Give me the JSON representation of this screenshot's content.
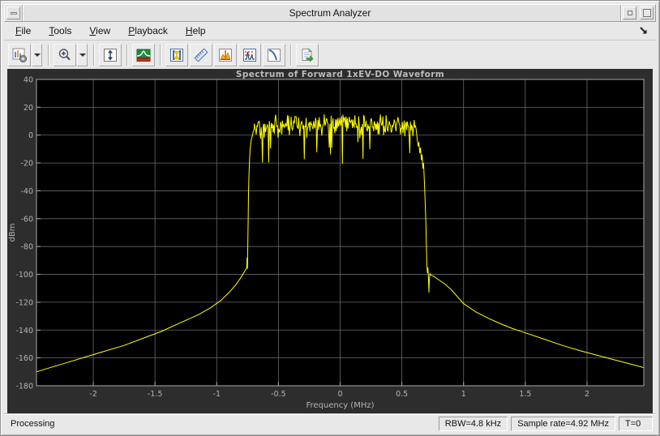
{
  "window": {
    "title": "Spectrum Analyzer"
  },
  "titlebar": {
    "icons": {
      "window_menu": "dash",
      "minimize": "small-square",
      "maximize": "large-square"
    }
  },
  "menu": {
    "items": [
      {
        "label": "File",
        "accel_index": 0
      },
      {
        "label": "Tools",
        "accel_index": 0
      },
      {
        "label": "View",
        "accel_index": 0
      },
      {
        "label": "Playback",
        "accel_index": 0
      },
      {
        "label": "Help",
        "accel_index": 0
      }
    ],
    "dock_icon": "arrow-down-right"
  },
  "toolbar": {
    "buttons": [
      {
        "name": "scope-options",
        "icon": "scope-settings-icon",
        "dropdown": true
      },
      {
        "name": "zoom-in",
        "icon": "zoom-in-icon",
        "dropdown": true
      },
      {
        "name": "autoscale-y",
        "icon": "autoscale-y-icon"
      },
      {
        "name": "spectrum-settings",
        "icon": "spectrum-settings-icon"
      },
      {
        "name": "cursor-measurements",
        "icon": "cursor-measurements-icon"
      },
      {
        "name": "signal-statistics",
        "icon": "ruler-icon"
      },
      {
        "name": "peak-finder",
        "icon": "peak-finder-icon"
      },
      {
        "name": "distortion-measurements",
        "icon": "distortion-measurements-icon"
      },
      {
        "name": "ccdf-measurements",
        "icon": "ccdf-measurements-icon"
      },
      {
        "name": "export",
        "icon": "export-icon"
      }
    ]
  },
  "statusbar": {
    "status": "Processing",
    "rbw": "RBW=4.8 kHz",
    "sample_rate": "Sample rate=4.92 MHz",
    "time": "T=0"
  },
  "colors": {
    "trace": "#ffff00",
    "axes_bg": "#000000",
    "figure_bg": "#2d2d2d",
    "grid": "#6a6a6a",
    "frame": "#a8a8a8",
    "tick_text": "#b4b4b4",
    "title_text": "#bcbcbc"
  },
  "chart_data": {
    "type": "line",
    "title": "Spectrum of Forward 1xEV-DO Waveform",
    "xlabel": "Frequency (MHz)",
    "ylabel": "dBm",
    "xlim": [
      -2.46,
      2.46
    ],
    "ylim": [
      -180,
      40
    ],
    "xticks": [
      -2,
      -1.5,
      -1,
      -0.5,
      0,
      0.5,
      1,
      1.5,
      2
    ],
    "yticks": [
      40,
      20,
      0,
      -20,
      -40,
      -60,
      -80,
      -100,
      -120,
      -140,
      -160,
      -180
    ],
    "grid": true,
    "legend": "none",
    "series": [
      {
        "name": "spectrum",
        "color": "#ffff00",
        "left_tail": [
          [
            -2.46,
            -170
          ],
          [
            -2.35,
            -167
          ],
          [
            -2.2,
            -163
          ],
          [
            -2.05,
            -159
          ],
          [
            -1.9,
            -155
          ],
          [
            -1.75,
            -151
          ],
          [
            -1.6,
            -146
          ],
          [
            -1.45,
            -141
          ],
          [
            -1.3,
            -135
          ],
          [
            -1.15,
            -129
          ],
          [
            -1.05,
            -124
          ],
          [
            -0.97,
            -119
          ],
          [
            -0.9,
            -113
          ],
          [
            -0.85,
            -108
          ],
          [
            -0.81,
            -103
          ],
          [
            -0.785,
            -99.5
          ],
          [
            -0.768,
            -97
          ],
          [
            -0.76,
            -95.8
          ]
        ],
        "left_skirt": [
          [
            -0.757,
            -95
          ],
          [
            -0.754,
            -88
          ],
          [
            -0.751,
            -96
          ],
          [
            -0.748,
            -80
          ],
          [
            -0.745,
            -60
          ],
          [
            -0.742,
            -42
          ],
          [
            -0.738,
            -28
          ],
          [
            -0.733,
            -16
          ],
          [
            -0.727,
            -8
          ],
          [
            -0.719,
            -3
          ],
          [
            -0.71,
            0
          ],
          [
            -0.702,
            3
          ],
          [
            -0.697,
            4
          ]
        ],
        "passband_noise": {
          "x_start": -0.695,
          "x_end": 0.615,
          "points": 260,
          "mean": 5,
          "sigma": 4,
          "dome_amp": 2.5,
          "dome_half_width": 0.75,
          "clip_max": 15,
          "dip_probability": 0.09,
          "dip_extra_min": 6,
          "dip_extra_max": 28,
          "seed": 20127
        },
        "right_skirt": [
          [
            0.618,
            2
          ],
          [
            0.625,
            -3
          ],
          [
            0.632,
            -8
          ],
          [
            0.638,
            -5
          ],
          [
            0.645,
            -13
          ],
          [
            0.651,
            -9
          ],
          [
            0.658,
            -18
          ],
          [
            0.664,
            -14
          ],
          [
            0.67,
            -24
          ],
          [
            0.676,
            -20
          ],
          [
            0.682,
            -32
          ],
          [
            0.688,
            -45
          ],
          [
            0.694,
            -62
          ],
          [
            0.699,
            -80
          ],
          [
            0.703,
            -93
          ],
          [
            0.707,
            -99
          ],
          [
            0.711,
            -95
          ],
          [
            0.716,
            -104
          ],
          [
            0.719,
            -113
          ],
          [
            0.723,
            -103
          ],
          [
            0.728,
            -99.5
          ]
        ],
        "right_tail": [
          [
            0.735,
            -100.5
          ],
          [
            0.76,
            -101.5
          ],
          [
            0.8,
            -104
          ],
          [
            0.85,
            -107
          ],
          [
            0.9,
            -111
          ],
          [
            0.95,
            -116
          ],
          [
            1.0,
            -121
          ],
          [
            1.1,
            -127
          ],
          [
            1.2,
            -131.5
          ],
          [
            1.3,
            -135.5
          ],
          [
            1.4,
            -139
          ],
          [
            1.5,
            -142
          ],
          [
            1.65,
            -146.5
          ],
          [
            1.8,
            -151
          ],
          [
            1.95,
            -155
          ],
          [
            2.1,
            -158.5
          ],
          [
            2.25,
            -162
          ],
          [
            2.4,
            -165.5
          ],
          [
            2.46,
            -167
          ]
        ]
      }
    ]
  }
}
